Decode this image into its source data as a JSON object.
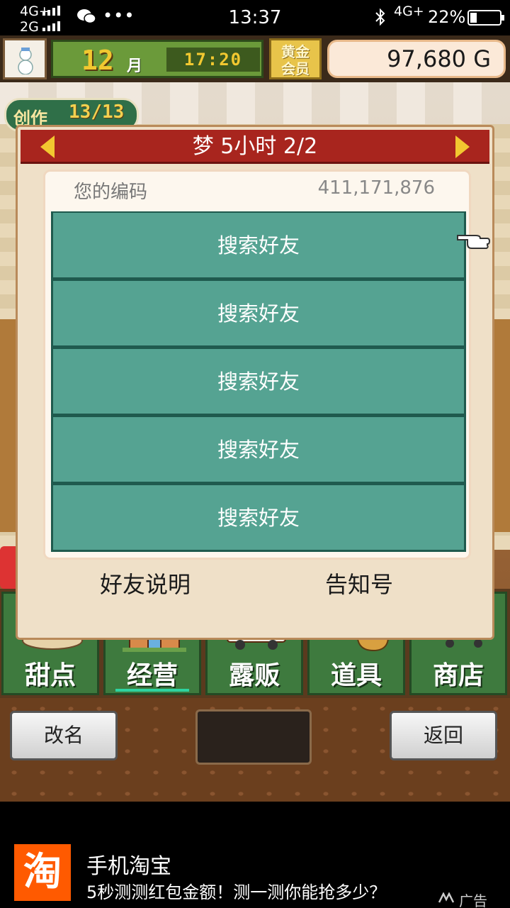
{
  "status_bar": {
    "network_top": "4G+",
    "network_bottom": "2G",
    "time": "13:37",
    "network_right": "4G+",
    "battery": "22%"
  },
  "top_bar": {
    "month": "12",
    "month_unit": "月",
    "time": "17:20",
    "member_badge": "黄金\n会员",
    "gold": "97,680 G"
  },
  "create_badge": {
    "label": "创作",
    "count": "13/13"
  },
  "dialog": {
    "title": "梦 5小时 2/2",
    "code_label": "您的编码",
    "code_value": "411,171,876",
    "slots": [
      {
        "label": "搜索好友"
      },
      {
        "label": "搜索好友"
      },
      {
        "label": "搜索好友"
      },
      {
        "label": "搜索好友"
      },
      {
        "label": "搜索好友"
      }
    ],
    "footer_left": "好友说明",
    "footer_right": "告知号"
  },
  "menu": {
    "items": [
      {
        "label": "甜点",
        "icon": "cake-icon"
      },
      {
        "label": "经营",
        "icon": "shop-building-icon"
      },
      {
        "label": "露贩",
        "icon": "food-truck-icon"
      },
      {
        "label": "道具",
        "icon": "item-bag-icon"
      },
      {
        "label": "商店",
        "icon": "shopping-cart-icon"
      }
    ],
    "selected_index": 1
  },
  "controls": {
    "left_button": "改名",
    "right_button": "返回"
  },
  "ad": {
    "logo_text": "淘",
    "title": "手机淘宝",
    "description": "5秒测测红包金额！测一测你能抢多少？",
    "tag": "广告"
  },
  "colors": {
    "dialog_header": "#a8251e",
    "slot_teal": "#55a392",
    "menu_green": "#3e7a3e",
    "taobao_orange": "#ff5a00"
  }
}
